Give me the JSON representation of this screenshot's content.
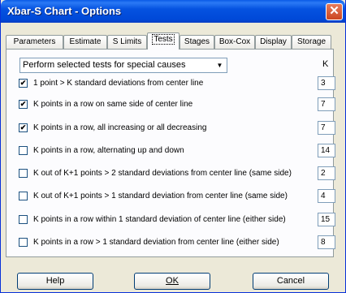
{
  "window": {
    "title": "Xbar-S Chart - Options"
  },
  "tabs": [
    {
      "label": "Parameters"
    },
    {
      "label": "Estimate"
    },
    {
      "label": "S Limits"
    },
    {
      "label": "Tests"
    },
    {
      "label": "Stages"
    },
    {
      "label": "Box-Cox"
    },
    {
      "label": "Display"
    },
    {
      "label": "Storage"
    }
  ],
  "tests": {
    "mode_select": "Perform selected tests for special causes",
    "k_header": "K",
    "rows": [
      {
        "label": "1 point > K standard deviations from center line",
        "checked": true,
        "k": "3"
      },
      {
        "label": "K points in a row on same side of center line",
        "checked": true,
        "k": "7"
      },
      {
        "label": "K points in a row, all increasing or all decreasing",
        "checked": true,
        "k": "7"
      },
      {
        "label": "K points in a row, alternating up and down",
        "checked": false,
        "k": "14"
      },
      {
        "label": "K out of K+1 points > 2 standard deviations from center line (same side)",
        "checked": false,
        "k": "2"
      },
      {
        "label": "K out of K+1 points > 1 standard deviation from center line (same side)",
        "checked": false,
        "k": "4"
      },
      {
        "label": "K points in a row within 1 standard deviation of center line (either side)",
        "checked": false,
        "k": "15"
      },
      {
        "label": "K points in a row > 1 standard deviation from center line (either side)",
        "checked": false,
        "k": "8"
      }
    ]
  },
  "buttons": {
    "help": "Help",
    "ok": "OK",
    "cancel": "Cancel"
  }
}
